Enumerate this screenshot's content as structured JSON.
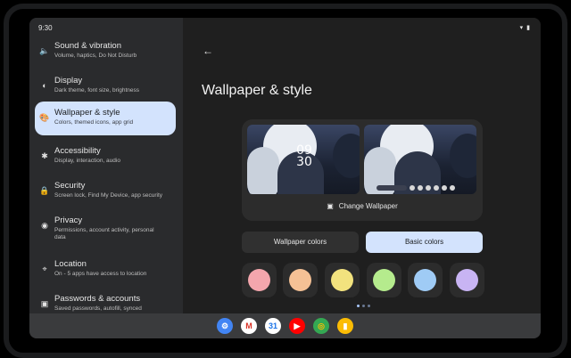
{
  "status_bar": {
    "time": "9:30"
  },
  "sidebar": {
    "items": [
      {
        "icon": "speaker-icon",
        "glyph": "🔈",
        "title": "Sound & vibration",
        "subtitle": "Volume, haptics, Do Not Disturb",
        "active": false
      },
      {
        "icon": "display-icon",
        "glyph": "◐",
        "title": "Display",
        "subtitle": "Dark theme, font size, brightness",
        "active": false
      },
      {
        "icon": "palette-icon",
        "glyph": "🎨",
        "title": "Wallpaper & style",
        "subtitle": "Colors, themed icons, app grid",
        "active": true
      },
      {
        "icon": "accessibility-icon",
        "glyph": "✱",
        "title": "Accessibility",
        "subtitle": "Display, interaction, audio",
        "active": false
      },
      {
        "icon": "lock-icon",
        "glyph": "🔒",
        "title": "Security",
        "subtitle": "Screen lock, Find My Device, app security",
        "active": false
      },
      {
        "icon": "privacy-eye-icon",
        "glyph": "◉",
        "title": "Privacy",
        "subtitle": "Permissions, account activity, personal data",
        "active": false
      },
      {
        "icon": "location-pin-icon",
        "glyph": "⌖",
        "title": "Location",
        "subtitle": "On - 5 apps have access to location",
        "active": false
      },
      {
        "icon": "key-card-icon",
        "glyph": "▣",
        "title": "Passwords & accounts",
        "subtitle": "Saved passwords, autofill, synced",
        "active": false
      }
    ]
  },
  "main": {
    "back_icon": "arrow-back-icon",
    "title": "Wallpaper & style",
    "lock_clock": "09\n30",
    "lock_hour": "09",
    "lock_minute": "30",
    "change_wallpaper": "Change Wallpaper",
    "tabs": {
      "wallpaper_colors": "Wallpaper colors",
      "basic_colors": "Basic colors"
    },
    "selected_tab": "Basic colors",
    "swatches": [
      "#f4a6ad",
      "#f5c195",
      "#f2e27e",
      "#b5eb8d",
      "#9fcbf5",
      "#c8b4f3"
    ]
  },
  "taskbar": {
    "apps": [
      {
        "name": "settings-app-icon",
        "glyph": "⚙",
        "bg": "#4285f4",
        "fg": "#ffffff"
      },
      {
        "name": "gmail-app-icon",
        "glyph": "M",
        "bg": "#ffffff",
        "fg": "#d93025"
      },
      {
        "name": "calendar-app-icon",
        "glyph": "31",
        "bg": "#ffffff",
        "fg": "#1a73e8"
      },
      {
        "name": "youtube-app-icon",
        "glyph": "▶",
        "bg": "#ff0000",
        "fg": "#ffffff"
      },
      {
        "name": "chrome-app-icon",
        "glyph": "◎",
        "bg": "#34a853",
        "fg": "#fbbc05"
      },
      {
        "name": "keep-app-icon",
        "glyph": "▮",
        "bg": "#fbbc04",
        "fg": "#ffffff"
      }
    ]
  }
}
